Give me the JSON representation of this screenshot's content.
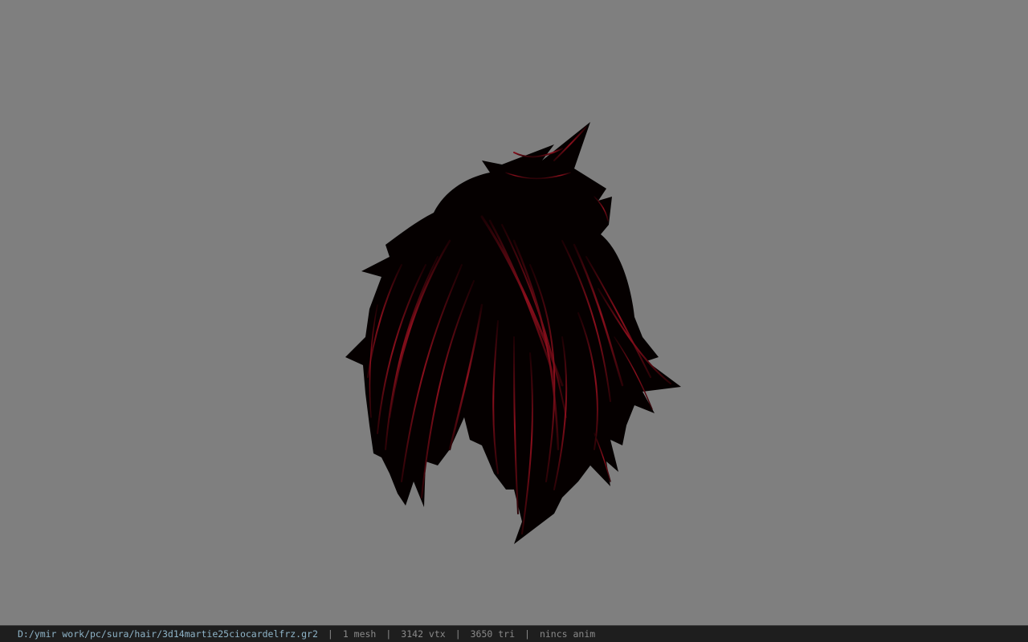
{
  "status": {
    "file_path": "D:/ymir work/pc/sura/hair/3d14martie25ciocardelfrz.gr2",
    "separator": "|",
    "meshes": "1 mesh",
    "vertices": "3142 vtx",
    "triangles": "3650 tri",
    "animation": "nincs anim"
  },
  "colors": {
    "viewport_background": "#7f7f7f",
    "status_bar_background": "#1e1e1e",
    "hair_base": "#050000",
    "hair_highlight": "#8a0f1c"
  }
}
